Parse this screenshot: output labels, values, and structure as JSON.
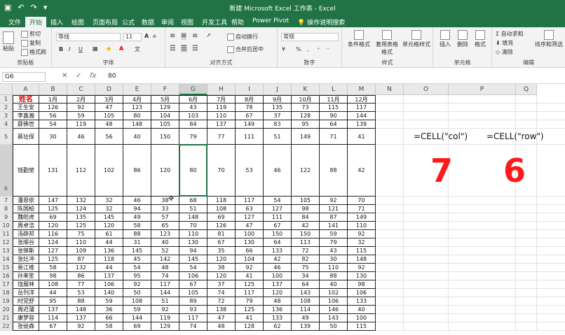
{
  "window": {
    "title": "新建 Microsoft Excel 工作表 - Excel"
  },
  "tabs": [
    "文件",
    "开始",
    "插入",
    "绘图",
    "页面布局",
    "公式",
    "数据",
    "审阅",
    "视图",
    "开发工具",
    "帮助",
    "Power Pivot",
    "操作说明搜索"
  ],
  "active_tab": "开始",
  "ribbon": {
    "clipboard": {
      "paste": "粘贴",
      "cut": "剪切",
      "copy": "复制",
      "format_painter": "格式刷",
      "label": "剪贴板"
    },
    "font": {
      "name": "等线",
      "size": "11",
      "bold": "B",
      "italic": "I",
      "underline": "U",
      "grow": "A",
      "shrink": "A",
      "label": "字体"
    },
    "alignment": {
      "wrap": "自动换行",
      "merge": "合并后居中",
      "label": "对齐方式"
    },
    "number": {
      "format": "常规",
      "percent": "%",
      "comma": ",",
      "label": "数字"
    },
    "styles": {
      "conditional": "条件格式",
      "table": "套用表格格式",
      "cell_styles": "单元格样式",
      "label": "样式"
    },
    "cells": {
      "insert": "插入",
      "delete": "删除",
      "format": "格式",
      "label": "单元格"
    },
    "editing": {
      "autosum": "自动求和",
      "fill": "填充",
      "clear": "清除",
      "sort": "排序和筛选",
      "label": "编辑"
    }
  },
  "formula_bar": {
    "name_box": "G6",
    "cancel": "✕",
    "enter": "✓",
    "fx": "fx",
    "value": "80"
  },
  "columns": [
    "A",
    "B",
    "C",
    "D",
    "E",
    "F",
    "G",
    "H",
    "I",
    "J",
    "K",
    "L",
    "M",
    "N",
    "O",
    "P",
    "Q"
  ],
  "header_row": [
    "姓名",
    "1月",
    "2月",
    "3月",
    "4月",
    "5月",
    "6月",
    "7月",
    "8月",
    "9月",
    "10月",
    "11月",
    "12月"
  ],
  "rows": [
    [
      "王生安",
      126,
      92,
      47,
      123,
      129,
      43,
      119,
      78,
      135,
      73,
      115,
      117
    ],
    [
      "李鑫瀚",
      56,
      59,
      105,
      80,
      104,
      103,
      110,
      67,
      37,
      128,
      90,
      144
    ],
    [
      "薛佛世",
      54,
      119,
      48,
      148,
      105,
      84,
      137,
      149,
      83,
      95,
      64,
      139
    ],
    [
      "蔡壮保",
      30,
      46,
      56,
      40,
      150,
      79,
      77,
      111,
      51,
      149,
      71,
      41
    ],
    [
      "钱勤堃",
      131,
      112,
      102,
      86,
      120,
      80,
      70,
      53,
      46,
      122,
      88,
      42
    ],
    [
      "潘恩依",
      147,
      132,
      32,
      46,
      38,
      68,
      118,
      117,
      54,
      105,
      92,
      70
    ],
    [
      "陈国柏",
      125,
      124,
      32,
      94,
      33,
      51,
      108,
      63,
      127,
      98,
      121,
      71
    ],
    [
      "魏皑虎",
      69,
      135,
      145,
      49,
      57,
      148,
      69,
      127,
      111,
      84,
      87,
      149
    ],
    [
      "周卓浩",
      120,
      125,
      120,
      58,
      65,
      70,
      126,
      47,
      67,
      42,
      141,
      110
    ],
    [
      "汤辟邦",
      116,
      75,
      61,
      88,
      123,
      110,
      81,
      100,
      150,
      150,
      59,
      92
    ],
    [
      "张顺谷",
      124,
      110,
      44,
      31,
      40,
      130,
      67,
      130,
      64,
      113,
      79,
      32
    ],
    [
      "张悌斯",
      127,
      109,
      136,
      145,
      52,
      94,
      35,
      66,
      133,
      72,
      43,
      115
    ],
    [
      "张灶冲",
      125,
      87,
      118,
      45,
      142,
      145,
      120,
      104,
      42,
      82,
      30,
      148
    ],
    [
      "易江维",
      58,
      132,
      44,
      54,
      48,
      54,
      38,
      92,
      46,
      75,
      110,
      92
    ],
    [
      "孙来笙",
      98,
      86,
      137,
      95,
      74,
      106,
      120,
      41,
      100,
      34,
      88,
      130
    ],
    [
      "饶展林",
      108,
      77,
      106,
      92,
      117,
      67,
      37,
      125,
      137,
      64,
      40,
      98
    ],
    [
      "岳列洋",
      44,
      53,
      140,
      50,
      144,
      105,
      74,
      117,
      120,
      143,
      102,
      106
    ],
    [
      "时党舒",
      95,
      88,
      59,
      108,
      51,
      89,
      72,
      79,
      48,
      108,
      106,
      133
    ],
    [
      "周迟蒲",
      137,
      148,
      36,
      59,
      92,
      93,
      138,
      125,
      136,
      114,
      146,
      40
    ],
    [
      "康梦容",
      114,
      137,
      66,
      144,
      119,
      117,
      47,
      41,
      133,
      49,
      143,
      100
    ],
    [
      "张徙森",
      67,
      92,
      58,
      69,
      129,
      74,
      48,
      128,
      62,
      139,
      50,
      115
    ]
  ],
  "row_numbers": [
    1,
    2,
    3,
    4,
    5,
    6,
    7,
    8,
    9,
    10,
    11,
    12,
    13,
    14,
    15,
    16,
    17,
    18,
    19,
    20,
    21,
    22
  ],
  "selected_cell": "G6",
  "formulas": {
    "col_formula": "=CELL(\"col\")",
    "row_formula": "=CELL(\"row\")",
    "col_result": "7",
    "row_result": "6"
  },
  "colors": {
    "brand": "#217346",
    "header_name": "#e00000",
    "result": "#ff1a1a"
  }
}
